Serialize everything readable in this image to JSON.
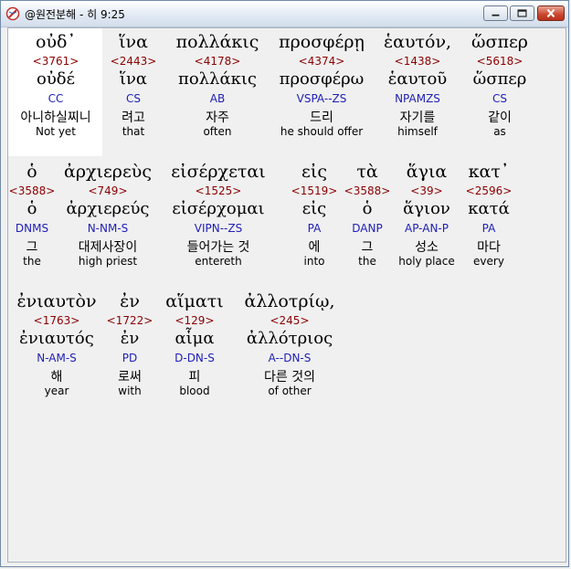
{
  "window": {
    "title": "@원전분해 - 히 9:25"
  },
  "lines": [
    [
      {
        "greek": "οὐδ᾽",
        "strong": "<3761>",
        "lemma": "οὐδέ",
        "parse": "CC",
        "korean": "아니하실찌니",
        "english": "Not yet"
      },
      {
        "greek": "ἵνα",
        "strong": "<2443>",
        "lemma": "ἵνα",
        "parse": "CS",
        "korean": "려고",
        "english": "that"
      },
      {
        "greek": "πολλάκις",
        "strong": "<4178>",
        "lemma": "πολλάκις",
        "parse": "AB",
        "korean": "자주",
        "english": "often"
      },
      {
        "greek": "προσφέρῃ",
        "strong": "<4374>",
        "lemma": "προσφέρω",
        "parse": "VSPA--ZS",
        "korean": "드리",
        "english": "he should offer"
      },
      {
        "greek": "ἑαυτόν,",
        "strong": "<1438>",
        "lemma": "ἑαυτοῦ",
        "parse": "NPAMZS",
        "korean": "자기를",
        "english": "himself"
      },
      {
        "greek": "ὥσπερ",
        "strong": "<5618>",
        "lemma": "ὥσπερ",
        "parse": "CS",
        "korean": "같이",
        "english": "as"
      }
    ],
    [
      {
        "greek": "ὁ",
        "strong": "<3588>",
        "lemma": "ὁ",
        "parse": "DNMS",
        "korean": "그",
        "english": "the"
      },
      {
        "greek": "ἀρχιερεὺς",
        "strong": "<749>",
        "lemma": "ἀρχιερεύς",
        "parse": "N-NM-S",
        "korean": "대제사장이",
        "english": "high priest"
      },
      {
        "greek": "εἰσέρχεται",
        "strong": "<1525>",
        "lemma": "εἰσέρχομαι",
        "parse": "VIPN--ZS",
        "korean": "들어가는 것",
        "english": "entereth"
      },
      {
        "greek": "εἰς",
        "strong": "<1519>",
        "lemma": "εἰς",
        "parse": "PA",
        "korean": "에",
        "english": "into"
      },
      {
        "greek": "τὰ",
        "strong": "<3588>",
        "lemma": "ὁ",
        "parse": "DANP",
        "korean": "그",
        "english": "the"
      },
      {
        "greek": "ἅγια",
        "strong": "<39>",
        "lemma": "ἅγιον",
        "parse": "AP-AN-P",
        "korean": "성소",
        "english": "holy place"
      },
      {
        "greek": "κατ᾽",
        "strong": "<2596>",
        "lemma": "κατά",
        "parse": "PA",
        "korean": "마다",
        "english": "every"
      }
    ],
    [
      {
        "greek": "ἐνιαυτὸν",
        "strong": "<1763>",
        "lemma": "ἐνιαυτός",
        "parse": "N-AM-S",
        "korean": "해",
        "english": "year"
      },
      {
        "greek": "ἐν",
        "strong": "<1722>",
        "lemma": "ἐν",
        "parse": "PD",
        "korean": "로써",
        "english": "with"
      },
      {
        "greek": "αἵματι",
        "strong": "<129>",
        "lemma": "αἷμα",
        "parse": "D-DN-S",
        "korean": "피",
        "english": "blood"
      },
      {
        "greek": "ἀλλοτρίῳ,",
        "strong": "<245>",
        "lemma": "ἀλλότριος",
        "parse": "A--DN-S",
        "korean": "다른 것의",
        "english": "of other"
      }
    ]
  ]
}
